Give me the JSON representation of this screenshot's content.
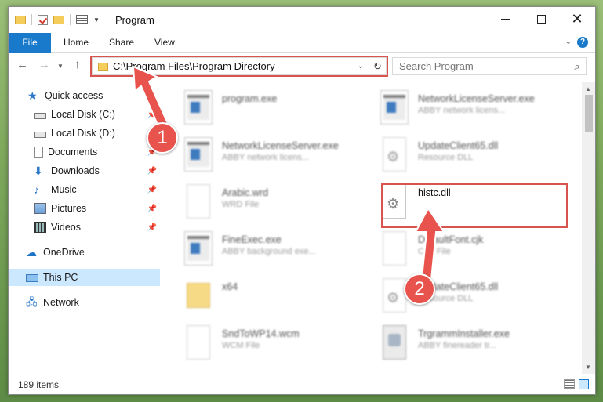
{
  "window": {
    "title": "Program"
  },
  "ribbon": {
    "tabs": [
      "File",
      "Home",
      "Share",
      "View"
    ],
    "file_color": "#1979ca",
    "help_label": "?"
  },
  "address": {
    "path": "C:\\Program Files\\Program Directory"
  },
  "search": {
    "placeholder": "Search Program"
  },
  "sidebar": {
    "items": [
      {
        "label": "Quick access",
        "icon": "star-icon"
      },
      {
        "label": "Local Disk (C:)",
        "icon": "disk-icon"
      },
      {
        "label": "Local Disk (D:)",
        "icon": "disk-icon"
      },
      {
        "label": "Documents",
        "icon": "documents-icon"
      },
      {
        "label": "Downloads",
        "icon": "download-icon"
      },
      {
        "label": "Music",
        "icon": "music-icon"
      },
      {
        "label": "Pictures",
        "icon": "pictures-icon"
      },
      {
        "label": "Videos",
        "icon": "videos-icon"
      },
      {
        "label": "OneDrive",
        "icon": "cloud-icon"
      },
      {
        "label": "This PC",
        "icon": "computer-icon"
      },
      {
        "label": "Network",
        "icon": "network-icon"
      }
    ]
  },
  "files": [
    {
      "name": "program.exe",
      "desc": "",
      "kind": "exe"
    },
    {
      "name": "NetworkLicenseServer.exe",
      "desc": "ABBY network licens...",
      "kind": "exe"
    },
    {
      "name": "NetworkLicenseServer.exe",
      "desc": "ABBY network licens...",
      "kind": "exe"
    },
    {
      "name": "UpdateClient65.dll",
      "desc": "Resource DLL",
      "kind": "dll"
    },
    {
      "name": "Arabic.wrd",
      "desc": "WRD File",
      "kind": "doc"
    },
    {
      "name": "histc.dll",
      "desc": "",
      "kind": "dll"
    },
    {
      "name": "FineExec.exe",
      "desc": "ABBY background exe...",
      "kind": "exe"
    },
    {
      "name": "DefaultFont.cjk",
      "desc": "CJK File",
      "kind": "doc"
    },
    {
      "name": "x64",
      "desc": "",
      "kind": "folder"
    },
    {
      "name": "UpdateClient65.dll",
      "desc": "Resource DLL",
      "kind": "dll"
    },
    {
      "name": "SndToWP14.wcm",
      "desc": "WCM File",
      "kind": "doc"
    },
    {
      "name": "TrgrammInstaller.exe",
      "desc": "ABBY finereader tr...",
      "kind": "setup"
    }
  ],
  "status": {
    "item_count": "189 items"
  },
  "callouts": {
    "step1": "1",
    "step2": "2",
    "color": "#e8534d"
  },
  "colors": {
    "selection": "#cce8ff",
    "highlight_box": "#d9534f"
  }
}
